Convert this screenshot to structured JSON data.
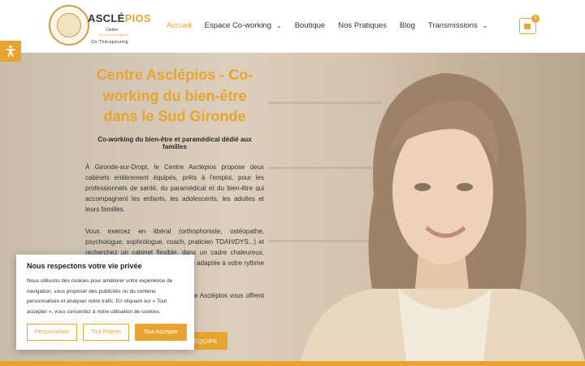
{
  "brand": {
    "name_main": "ASCLÉ",
    "name_accent": "PIOS",
    "tag_line_1": "Centre",
    "tag_line_2": "au coin d'être global",
    "tag_line_3": "Co-Thérapeuting"
  },
  "nav": {
    "items": [
      {
        "label": "Accueil",
        "active": true,
        "has_dropdown": false
      },
      {
        "label": "Espace Co-working",
        "active": false,
        "has_dropdown": true
      },
      {
        "label": "Boutique",
        "active": false,
        "has_dropdown": false
      },
      {
        "label": "Nos Pratiques",
        "active": false,
        "has_dropdown": false
      },
      {
        "label": "Blog",
        "active": false,
        "has_dropdown": false
      },
      {
        "label": "Transmissions",
        "active": false,
        "has_dropdown": true
      }
    ],
    "dropdown_glyph": "⌄"
  },
  "cart": {
    "count": "0",
    "icon": "shopping-bag-icon"
  },
  "hero": {
    "title": "Centre Asclépios - Co-working du bien-être dans le Sud Gironde",
    "subtitle": "Co-working du bien-être et paramédical dédié aux familles",
    "paragraph_1": "À Gironde-sur-Dropt, le Centre Asclépios propose deux cabinets entièrement équipés, prêts à l'emploi, pour les professionnels de santé, du paramédical et du bien-être qui accompagnent les enfants, les adolescents, les adultes et leurs familles.",
    "paragraph_2": "Vous exercez en libéral (orthophoniste, ostéopathe, psychologue, sophrologue, coach, praticien TDAH/DYS...) et recherchez un cabinet flexible, dans un cadre chaleureux, sans bail classique, avec une solution adaptée à votre rythme et votre activité ?",
    "paragraph_3": "Nos cabinets en co-working au Centre Asclépios vous offrent une installation simple et sereine.",
    "cta_label": "ÉQUIPE"
  },
  "accessibility": {
    "icon": "accessibility-icon"
  },
  "cookie": {
    "title": "Nous respectons votre vie privée",
    "text": "Nous utilisons des cookies pour améliorer votre expérience de navigation, vous proposer des publicités ou du contenu personnalisés et analyser notre trafic. En cliquant sur « Tout accepter », vous consentez à notre utilisation de cookies.",
    "btn_customize": "Personnaliser",
    "btn_reject": "Tout Rejeter",
    "btn_accept": "Tout Accepter"
  },
  "colors": {
    "accent": "#e8a430",
    "text": "#333333"
  }
}
